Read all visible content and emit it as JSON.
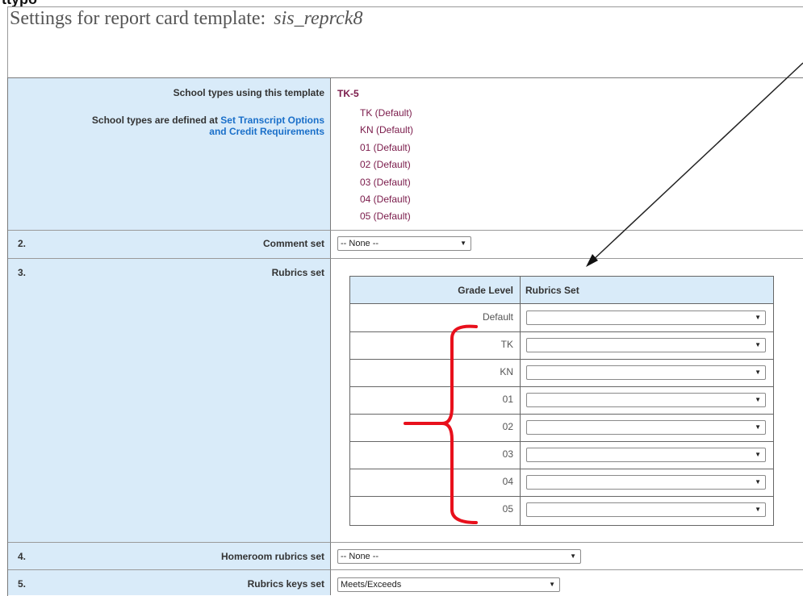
{
  "page": {
    "top_crop_text": "ttypo",
    "title_prefix": "Settings for report card template:",
    "template_name": "sis_reprck8"
  },
  "row1": {
    "label": "School types using this template",
    "note_prefix": "School types are defined at",
    "link_line1": "Set Transcript Options",
    "link_line2": "and Credit Requirements",
    "school_type": "TK-5",
    "grades": [
      "TK  (Default)",
      "KN  (Default)",
      "01  (Default)",
      "02  (Default)",
      "03  (Default)",
      "04  (Default)",
      "05  (Default)"
    ]
  },
  "row2": {
    "num": "2.",
    "label": "Comment set",
    "value": "-- None --"
  },
  "row3": {
    "num": "3.",
    "label": "Rubrics set",
    "table": {
      "col1": "Grade Level",
      "col2": "Rubrics Set",
      "levels": [
        "Default",
        "TK",
        "KN",
        "01",
        "02",
        "03",
        "04",
        "05"
      ],
      "values": [
        "",
        "",
        "",
        "",
        "",
        "",
        "",
        ""
      ]
    }
  },
  "row4": {
    "num": "4.",
    "label": "Homeroom rubrics set",
    "value": "-- None --"
  },
  "row5": {
    "num": "5.",
    "label": "Rubrics keys set",
    "value": "Meets/Exceeds"
  },
  "annotation": {
    "arrow_color": "#222222",
    "bracket_color": "#e8101c"
  }
}
